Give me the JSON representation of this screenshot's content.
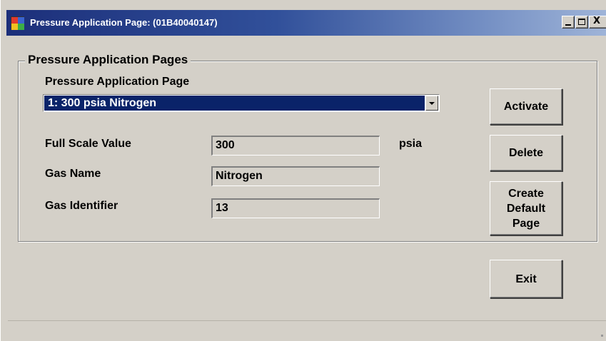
{
  "window": {
    "title": "Pressure Application Page: (01B40040147)",
    "controls": {
      "minimize": "_",
      "close": "X"
    }
  },
  "group": {
    "legend": "Pressure Application Pages",
    "page_selector": {
      "label": "Pressure Application Page",
      "selected": "1:  300 psia Nitrogen"
    },
    "fields": {
      "full_scale": {
        "label": "Full Scale Value",
        "value": "300",
        "unit": "psia"
      },
      "gas_name": {
        "label": "Gas Name",
        "value": "Nitrogen"
      },
      "gas_identifier": {
        "label": "Gas Identifier",
        "value": "13"
      }
    }
  },
  "buttons": {
    "activate": "Activate",
    "delete": "Delete",
    "create_default": "Create\nDefault\nPage",
    "exit": "Exit"
  },
  "colors": {
    "titlebar_start": "#1c2f7a",
    "titlebar_end": "#9fb4d8",
    "selection": "#0a2369",
    "face": "#d4d0c8"
  }
}
